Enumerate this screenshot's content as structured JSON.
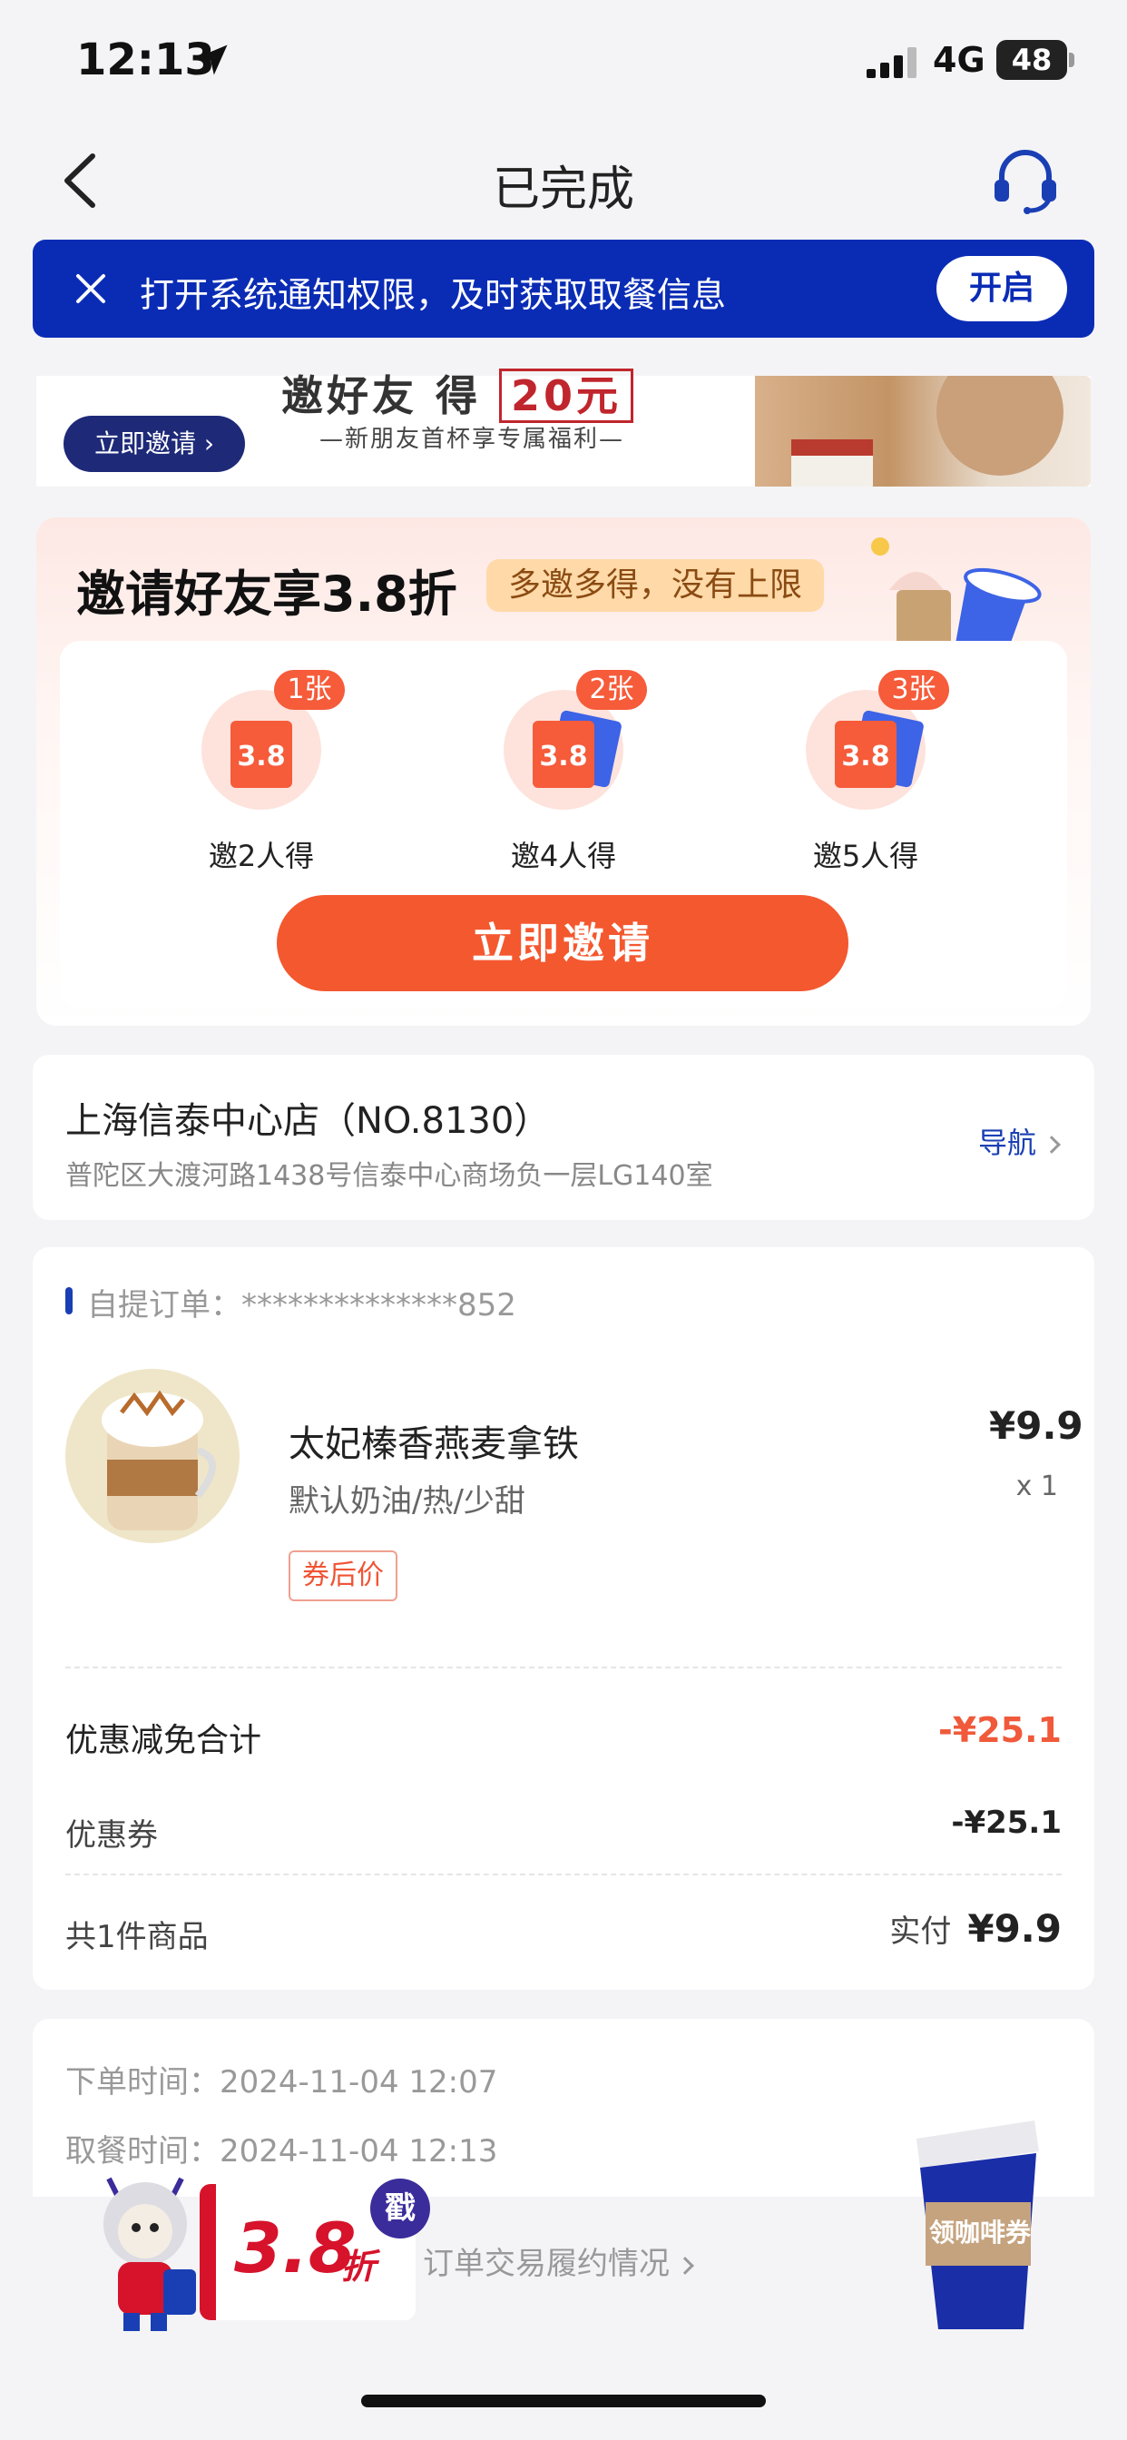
{
  "status_bar": {
    "time": "12:13",
    "network": "4G",
    "battery": "48"
  },
  "nav": {
    "title": "已完成"
  },
  "notice": {
    "text": "打开系统通知权限，及时获取取餐信息",
    "button": "开启"
  },
  "promo_banner": {
    "headline": "邀好友 得",
    "headline_amount": "20元",
    "subline": "—新朋友首杯享专属福利—",
    "button": "立即邀请"
  },
  "invite": {
    "title": "邀请好友享3.8折",
    "tag": "多邀多得，没有上限",
    "tiers": [
      {
        "badge": "1张",
        "ticket": "3.8",
        "label": "邀2人得"
      },
      {
        "badge": "2张",
        "ticket": "3.8",
        "label": "邀4人得"
      },
      {
        "badge": "3张",
        "ticket": "3.8",
        "label": "邀5人得"
      }
    ],
    "cta": "立即邀请"
  },
  "store": {
    "name": "上海信泰中心店（NO.8130）",
    "address": "普陀区大渡河路1438号信泰中心商场负一层LG140室",
    "nav_label": "导航"
  },
  "order": {
    "label": "自提订单：",
    "number": "**************852",
    "product": {
      "name": "太妃榛香燕麦拿铁",
      "spec": "默认奶油/热/少甜",
      "tag": "券后价",
      "price": "¥9.9",
      "qty": "x 1"
    },
    "discount_total_label": "优惠减免合计",
    "discount_total_value": "-¥25.1",
    "coupon_label": "优惠券",
    "coupon_value": "-¥25.1",
    "count_label": "共1件商品",
    "paid_label": "实付",
    "paid_value": "¥9.9"
  },
  "times": {
    "order_time": "下单时间：2024-11-04 12:07",
    "pickup_time": "取餐时间：2024-11-04 12:13"
  },
  "bottom": {
    "fulfil_link": "订单交易履约情况",
    "discount_num": "3.8",
    "discount_unit": "折",
    "stamp": "戳",
    "cup_label": "领咖啡券"
  },
  "colors": {
    "brand_blue": "#0a2cb5",
    "accent_orange": "#f4582f",
    "price_red": "#f05a3a"
  }
}
